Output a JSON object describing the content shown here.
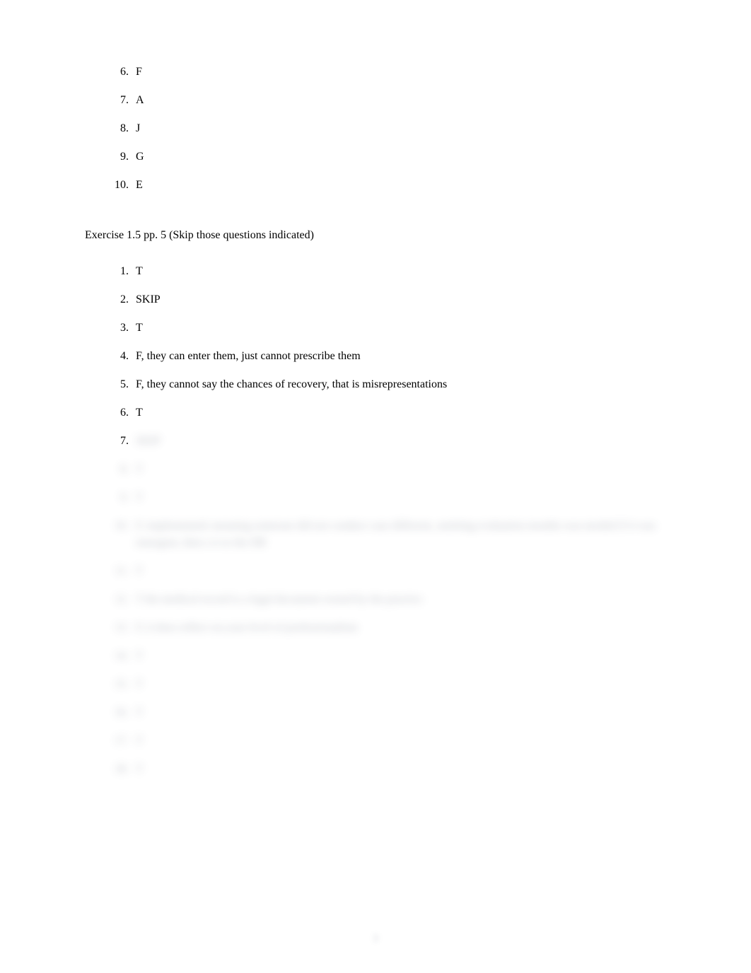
{
  "topList": {
    "items": [
      {
        "num": "6.",
        "text": "F"
      },
      {
        "num": "7.",
        "text": "A"
      },
      {
        "num": "8.",
        "text": "J"
      },
      {
        "num": "9.",
        "text": "G"
      },
      {
        "num": "10.",
        "text": "E"
      }
    ]
  },
  "section": {
    "heading": "Exercise 1.5 pp. 5 (Skip those questions indicated)",
    "items": [
      {
        "num": "1.",
        "text": "T",
        "blurred": false
      },
      {
        "num": "2.",
        "text": "SKIP",
        "blurred": false
      },
      {
        "num": "3.",
        "text": "T",
        "blurred": false
      },
      {
        "num": "4.",
        "text": "F, they can enter them, just cannot prescribe them",
        "blurred": false
      },
      {
        "num": "5.",
        "text": "F, they cannot say the chances of recovery, that is misrepresentations",
        "blurred": false
      },
      {
        "num": "6.",
        "text": "T",
        "blurred": false
      },
      {
        "num": "7.",
        "text": "SKIP",
        "numBlurred": false,
        "blurred": true
      },
      {
        "num": "8.",
        "text": "T",
        "blurred": true
      },
      {
        "num": "9.",
        "text": "T",
        "blurred": true
      },
      {
        "num": "10.",
        "text": "F, implemented; meaning someone did not conduct case different, omitting evaluation months was needed if it was emergent, then c/o to the DR",
        "blurred": true
      },
      {
        "num": "11.",
        "text": "T",
        "blurred": true
      },
      {
        "num": "12.",
        "text": "T the medical record is a legal document owned by the practice",
        "blurred": true
      },
      {
        "num": "13.",
        "text": "F, it does reflect on your level of professionalism",
        "blurred": true
      },
      {
        "num": "14.",
        "text": "T",
        "blurred": true
      },
      {
        "num": "15.",
        "text": "T",
        "blurred": true
      },
      {
        "num": "16.",
        "text": "T",
        "blurred": true
      },
      {
        "num": "17.",
        "text": "T",
        "blurred": true
      },
      {
        "num": "18.",
        "text": "T",
        "blurred": true
      }
    ]
  },
  "pageNumber": "3"
}
